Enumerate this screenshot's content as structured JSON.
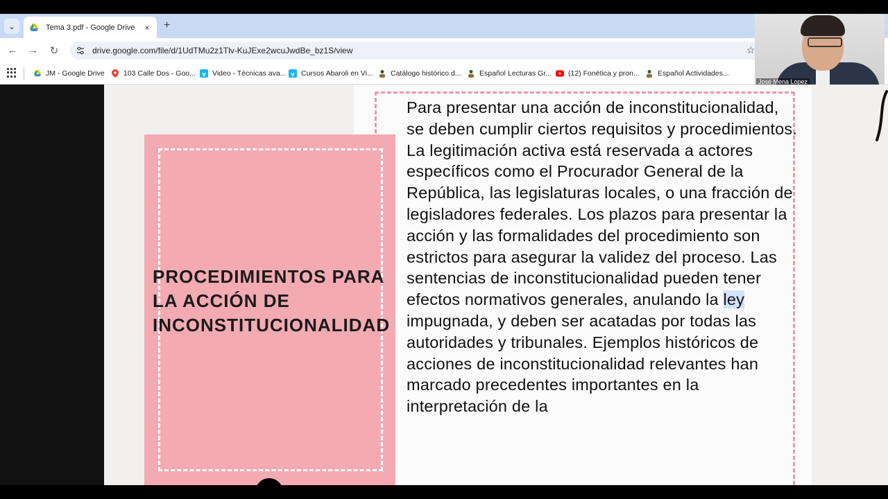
{
  "browser": {
    "tab": {
      "title": "Tema 3.pdf - Google Drive",
      "close": "×"
    },
    "new_tab": "+",
    "nav": {
      "back": "←",
      "forward": "→",
      "reload": "↻"
    },
    "url": "drive.google.com/file/d/1UdTMu2z1Tlv-KuJExe2wcuJwdBe_bz1S/view",
    "star": "☆",
    "bookmarks": [
      {
        "label": "JM - Google Drive",
        "icon": "google-drive-icon"
      },
      {
        "label": "103 Calle Dos - Goo...",
        "icon": "maps-pin-icon"
      },
      {
        "label": "Video - Técnicas ava...",
        "icon": "vimeo-icon"
      },
      {
        "label": "Cursos Abaroli en Vi...",
        "icon": "vimeo-icon"
      },
      {
        "label": "Catálogo histórico d...",
        "icon": "person-icon"
      },
      {
        "label": "Español Lecturas Gr...",
        "icon": "person-icon"
      },
      {
        "label": "(12) Fonética y pron...",
        "icon": "youtube-icon"
      },
      {
        "label": "Español Actividades...",
        "icon": "person-icon"
      }
    ]
  },
  "webcam": {
    "name": "José Mena Lopez"
  },
  "document": {
    "card_title": "PROCEDIMIENTOS PARA\nLA ACCIÓN DE\nINCONSTITUCIONALIDAD",
    "body_before": "Para presentar una acción de inconstitucionalidad, se deben cumplir ciertos requisitos y procedimientos. La legitimación activa está reservada a actores específicos como el Procurador General de la República, las legislaturas locales, o una fracción de legisladores federales. Los plazos para presentar la acción y las formalidades del procedimiento son estrictos para asegurar la validez del proceso. Las sentencias de inconstitucionalidad pueden tener efectos normativos generales, anulando la ",
    "body_highlight": "ley",
    "body_after": " impugnada, y deben ser acatadas por todas las autoridades y tribunales. Ejemplos históricos de acciones de inconstitucionalidad relevantes han marcado precedentes importantes en la interpretación de la"
  },
  "colors": {
    "card_pink": "#f3aab3",
    "dashed_border_pink": "#e69aa9",
    "tabstrip": "#c9d9f4",
    "highlight": "#d3e3fd"
  }
}
